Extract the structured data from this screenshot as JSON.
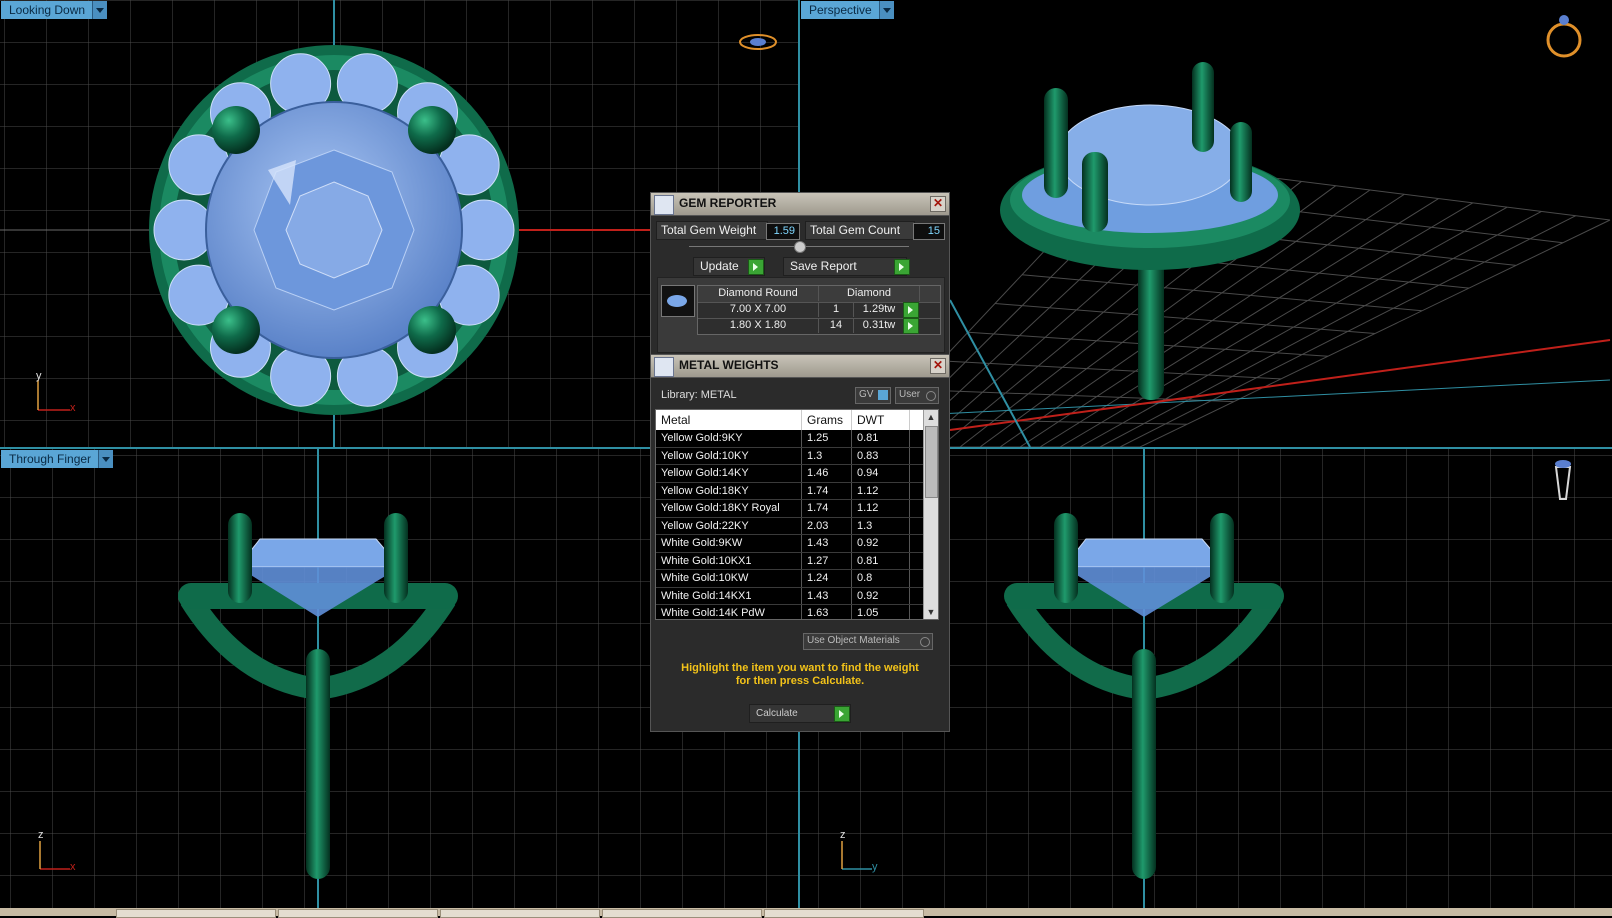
{
  "viewports": {
    "top_left": {
      "label": "Looking Down",
      "axis_v": "y",
      "axis_h": "x"
    },
    "top_right": {
      "label": "Perspective"
    },
    "bottom_left": {
      "label": "Through Finger",
      "axis_v": "z",
      "axis_h": "x"
    },
    "bottom_right": {
      "axis_v": "z",
      "axis_h": "y"
    }
  },
  "gem_reporter": {
    "title": "GEM REPORTER",
    "total_weight_label": "Total Gem Weight",
    "total_weight_value": "1.59",
    "total_count_label": "Total Gem Count",
    "total_count_value": "15",
    "update_label": "Update",
    "save_report_label": "Save Report",
    "table_headers": [
      "Diamond Round",
      "Diamond"
    ],
    "rows": [
      {
        "size": "7.00 X 7.00",
        "count": "1",
        "weight": "1.29tw"
      },
      {
        "size": "1.80 X 1.80",
        "count": "14",
        "weight": "0.31tw"
      }
    ]
  },
  "metal_weights": {
    "title": "METAL WEIGHTS",
    "library_label": "Library: METAL",
    "gv_label": "GV",
    "user_label": "User",
    "headers": [
      "Metal",
      "Grams",
      "DWT"
    ],
    "rows": [
      [
        "Yellow Gold:9KY",
        "1.25",
        "0.81"
      ],
      [
        "Yellow Gold:10KY",
        "1.3",
        "0.83"
      ],
      [
        "Yellow Gold:14KY",
        "1.46",
        "0.94"
      ],
      [
        "Yellow Gold:18KY",
        "1.74",
        "1.12"
      ],
      [
        "Yellow Gold:18KY Royal",
        "1.74",
        "1.12"
      ],
      [
        "Yellow Gold:22KY",
        "2.03",
        "1.3"
      ],
      [
        "White Gold:9KW",
        "1.43",
        "0.92"
      ],
      [
        "White Gold:10KX1",
        "1.27",
        "0.81"
      ],
      [
        "White Gold:10KW",
        "1.24",
        "0.8"
      ],
      [
        "White Gold:14KX1",
        "1.43",
        "0.92"
      ],
      [
        "White Gold:14K PdW",
        "1.63",
        "1.05"
      ]
    ],
    "use_object_materials_label": "Use Object Materials",
    "hint_line1": "Highlight the item you want to find the weight",
    "hint_line2": "for then press Calculate.",
    "calculate_label": "Calculate"
  },
  "colors": {
    "metal_green": "#0f6b4a",
    "gem_blue": "#7aa7e8",
    "grid_line": "#4a4a4a",
    "axis_cyan": "#2f8fa3",
    "axis_red": "#c0201a",
    "label_blue": "#5aa6d6",
    "hint_yellow": "#f2c219"
  }
}
